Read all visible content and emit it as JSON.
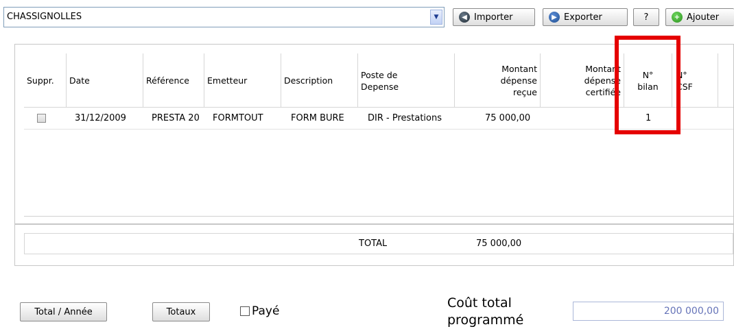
{
  "toolbar": {
    "combo_value": "CHASSIGNOLLES",
    "importer": "Importer",
    "exporter": "Exporter",
    "help": "?",
    "ajouter": "Ajouter"
  },
  "table": {
    "headers": {
      "suppr": "Suppr.",
      "date": "Date",
      "reference": "Référence",
      "emetteur": "Emetteur",
      "description": "Description",
      "poste_l1": "Poste de",
      "poste_l2": "Depense",
      "montant_recu_l1": "Montant",
      "montant_recu_l2": "dépense",
      "montant_recu_l3": "reçue",
      "montant_cert_l1": "Montant",
      "montant_cert_l2": "dépense",
      "montant_cert_l3": "certifiée",
      "bilan_l1": "N°",
      "bilan_l2": "bilan",
      "csf_l1": "N°",
      "csf_l2": "CSF"
    },
    "rows": [
      {
        "date": "31/12/2009",
        "reference": "PRESTA 20",
        "emetteur": "FORMTOUT",
        "description": "FORM BURE",
        "poste": "DIR - Prestations",
        "montant_recu": "75 000,00",
        "montant_cert": "",
        "bilan": "1",
        "csf": ""
      }
    ]
  },
  "totals": {
    "label": "TOTAL",
    "montant_recu": "75 000,00"
  },
  "bottom": {
    "total_annee": "Total / Année",
    "totaux": "Totaux",
    "paye": "Payé",
    "cout_l1": "Coût total",
    "cout_l2": "programmé",
    "cout_value": "200 000,00"
  },
  "colors": {
    "highlight": "#e50000",
    "field_text": "#6573b8"
  }
}
